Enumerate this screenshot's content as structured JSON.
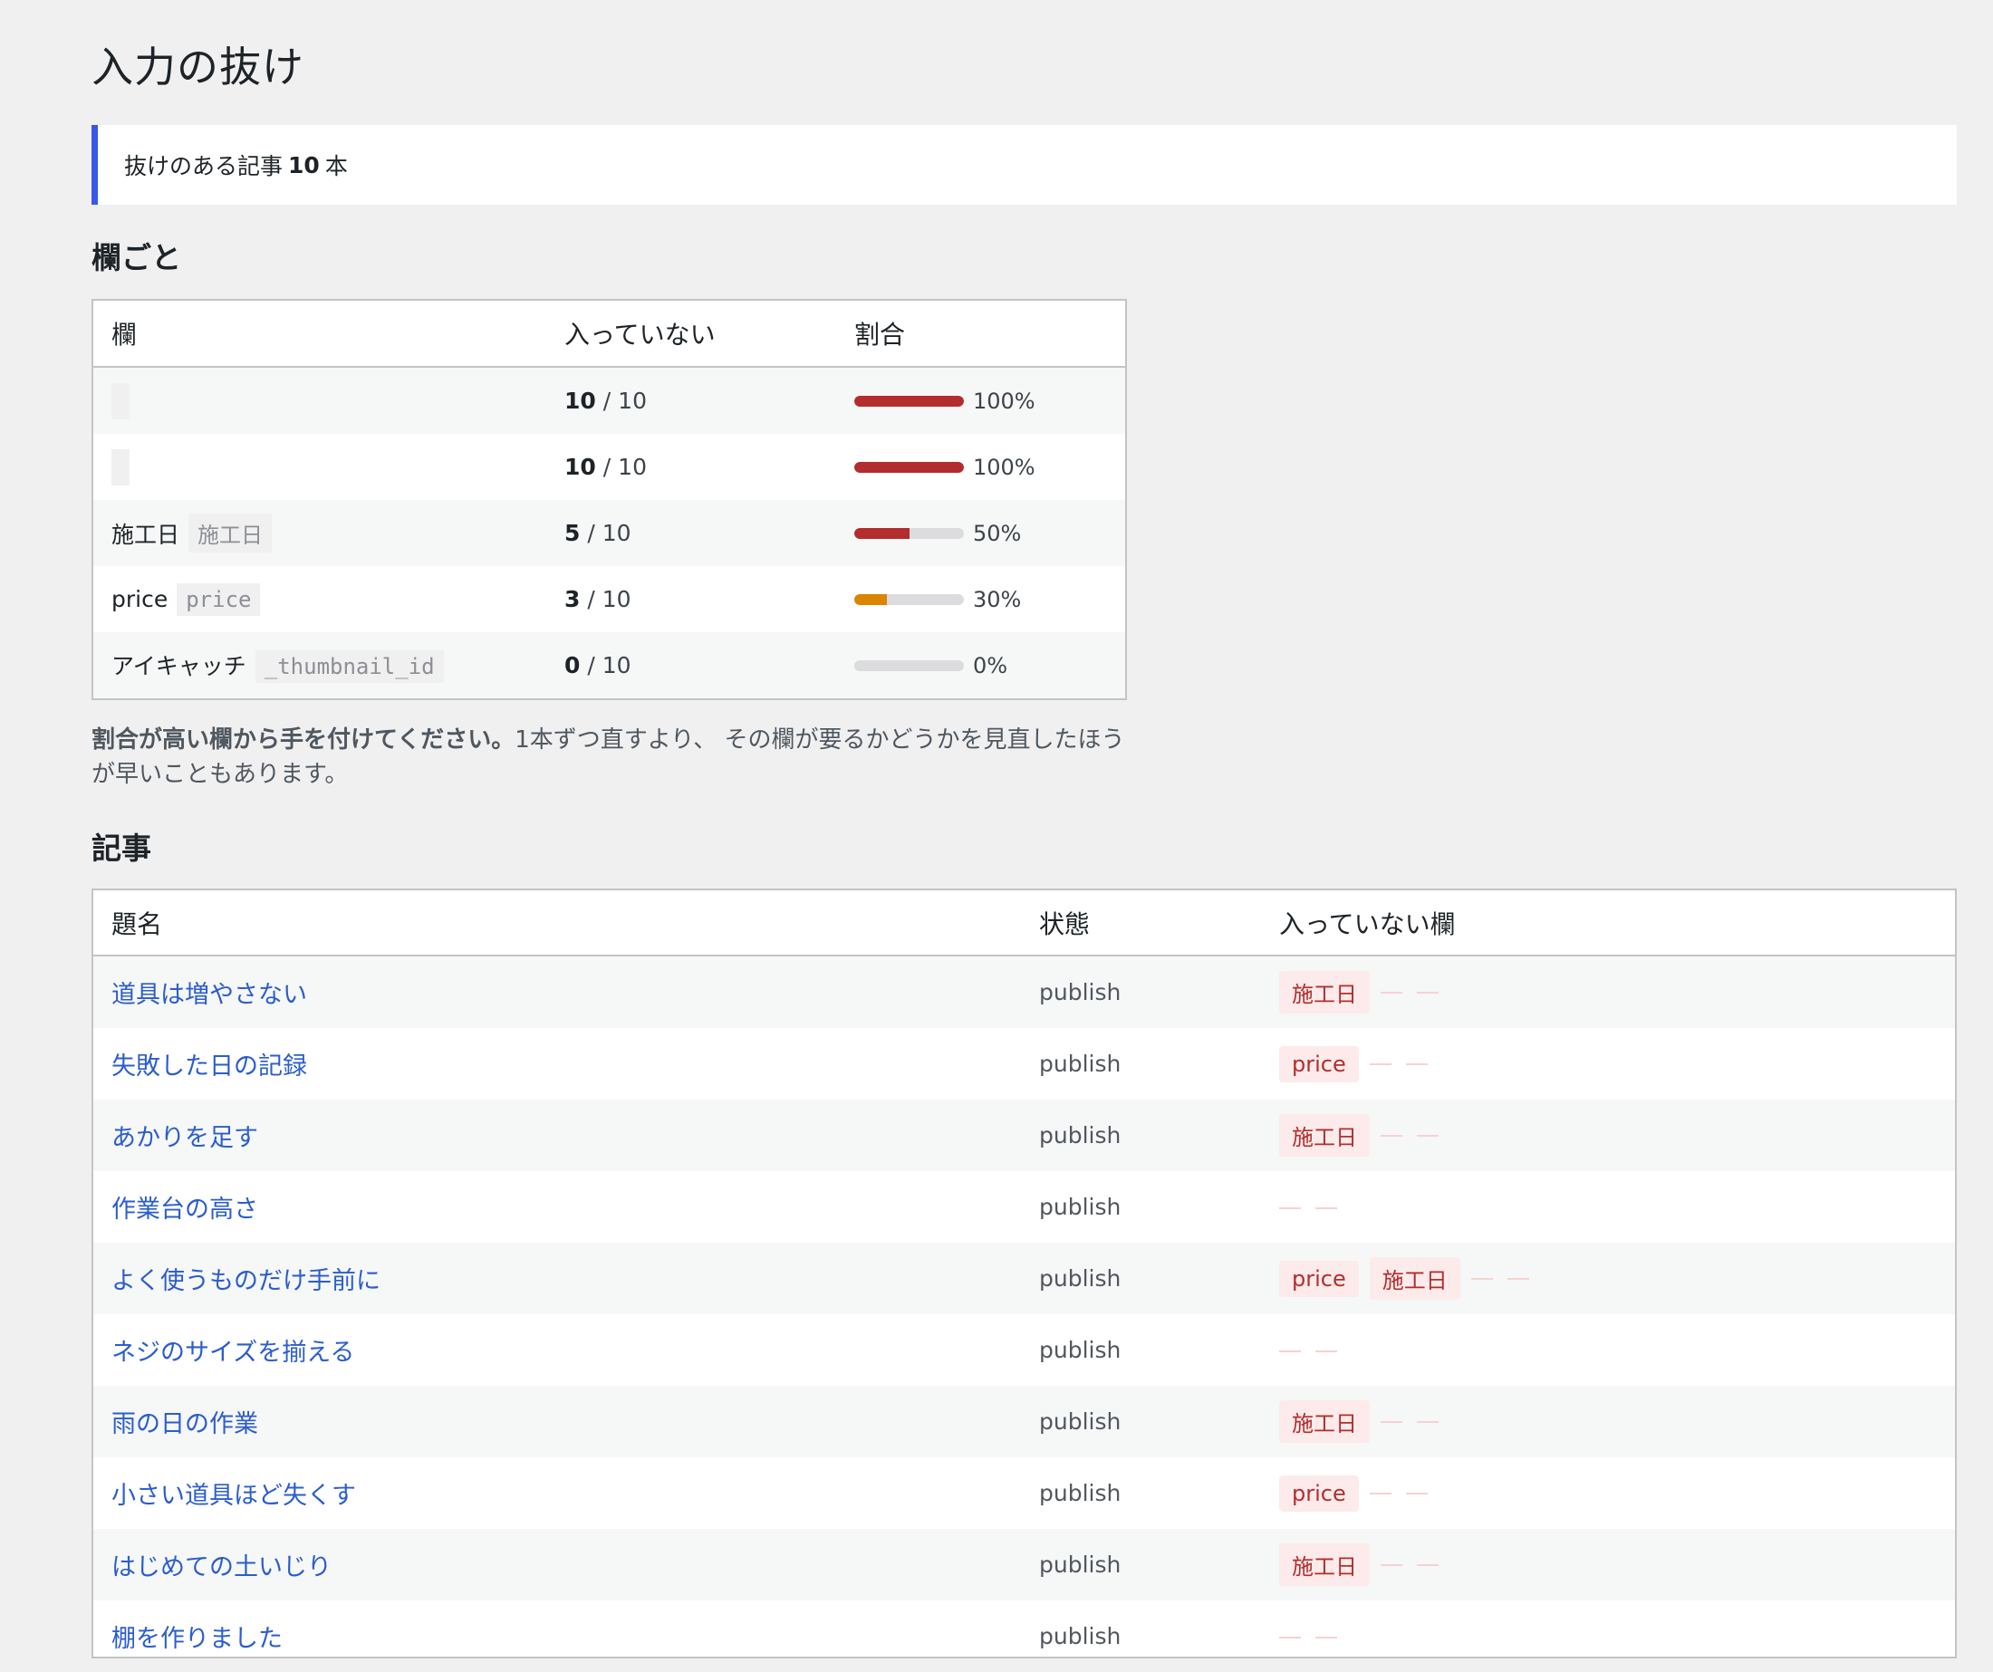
{
  "page_title": "入力の抜け",
  "notice": {
    "prefix": "抜けのある記事",
    "count": "10",
    "suffix": "本"
  },
  "fields_section": {
    "heading": "欄ごと",
    "columns": [
      "欄",
      "入っていない",
      "割合"
    ],
    "rows": [
      {
        "label": "",
        "key": "",
        "missing": "10",
        "total": "/ 10",
        "percent": 100,
        "percent_label": "100%",
        "color": "#b32d2e"
      },
      {
        "label": "",
        "key": "",
        "missing": "10",
        "total": "/ 10",
        "percent": 100,
        "percent_label": "100%",
        "color": "#b32d2e"
      },
      {
        "label": "施工日",
        "key": "施工日",
        "missing": "5",
        "total": "/ 10",
        "percent": 50,
        "percent_label": "50%",
        "color": "#b32d2e"
      },
      {
        "label": "price",
        "key": "price",
        "missing": "3",
        "total": "/ 10",
        "percent": 30,
        "percent_label": "30%",
        "color": "#d98500"
      },
      {
        "label": "アイキャッチ",
        "key": "_thumbnail_id",
        "missing": "0",
        "total": "/ 10",
        "percent": 0,
        "percent_label": "0%",
        "color": "#b32d2e"
      }
    ],
    "note_bold": "割合が高い欄から手を付けてください。",
    "note_rest": "1本ずつ直すより、 その欄が要るかどうかを見直したほうが早いこともあります。"
  },
  "posts_section": {
    "heading": "記事",
    "columns": [
      "題名",
      "状態",
      "入っていない欄"
    ],
    "rows": [
      {
        "title": "道具は増やさない",
        "status": "publish",
        "tags": [
          "施工日"
        ]
      },
      {
        "title": "失敗した日の記録",
        "status": "publish",
        "tags": [
          "price"
        ]
      },
      {
        "title": "あかりを足す",
        "status": "publish",
        "tags": [
          "施工日"
        ]
      },
      {
        "title": "作業台の高さ",
        "status": "publish",
        "tags": []
      },
      {
        "title": "よく使うものだけ手前に",
        "status": "publish",
        "tags": [
          "price",
          "施工日"
        ]
      },
      {
        "title": "ネジのサイズを揃える",
        "status": "publish",
        "tags": []
      },
      {
        "title": "雨の日の作業",
        "status": "publish",
        "tags": [
          "施工日"
        ]
      },
      {
        "title": "小さい道具ほど失くす",
        "status": "publish",
        "tags": [
          "price"
        ]
      },
      {
        "title": "はじめての土いじり",
        "status": "publish",
        "tags": [
          "施工日"
        ]
      },
      {
        "title": "棚を作りました",
        "status": "publish",
        "tags": []
      }
    ]
  }
}
